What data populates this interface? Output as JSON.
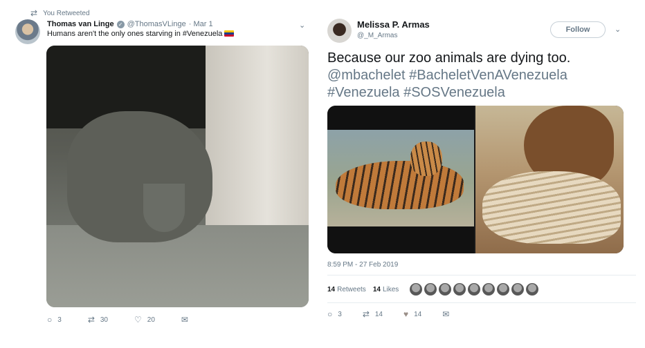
{
  "left_tweet": {
    "retweet_notice": "You Retweeted",
    "author_name": "Thomas van Linge",
    "author_handle": "@ThomasVLinge",
    "date": "· Mar 1",
    "text": "Humans aren't the only ones starving in #Venezuela",
    "actions": {
      "replies": "3",
      "retweets": "30",
      "likes": "20"
    }
  },
  "right_tweet": {
    "author_name": "Melissa P. Armas",
    "author_handle": "@_M_Armas",
    "follow_label": "Follow",
    "text_plain": "Because our zoo animals are dying too.",
    "text_tags": "@mbachelet #BacheletVenAVenezuela #Venezuela #SOSVenezuela",
    "timestamp": "8:59 PM - 27 Feb 2019",
    "retweets_count": "14",
    "retweets_label": "Retweets",
    "likes_count": "14",
    "likes_label": "Likes",
    "actions": {
      "replies": "3",
      "retweets": "14",
      "likes": "14"
    }
  },
  "icons": {
    "reply": "reply-icon",
    "retweet": "retweet-icon",
    "like": "heart-icon",
    "dm": "envelope-icon",
    "chevron": "chevron-down-icon",
    "verified": "verified-badge-icon"
  },
  "colors": {
    "text": "#14171a",
    "muted": "#657786",
    "border": "#e6ecf0"
  }
}
